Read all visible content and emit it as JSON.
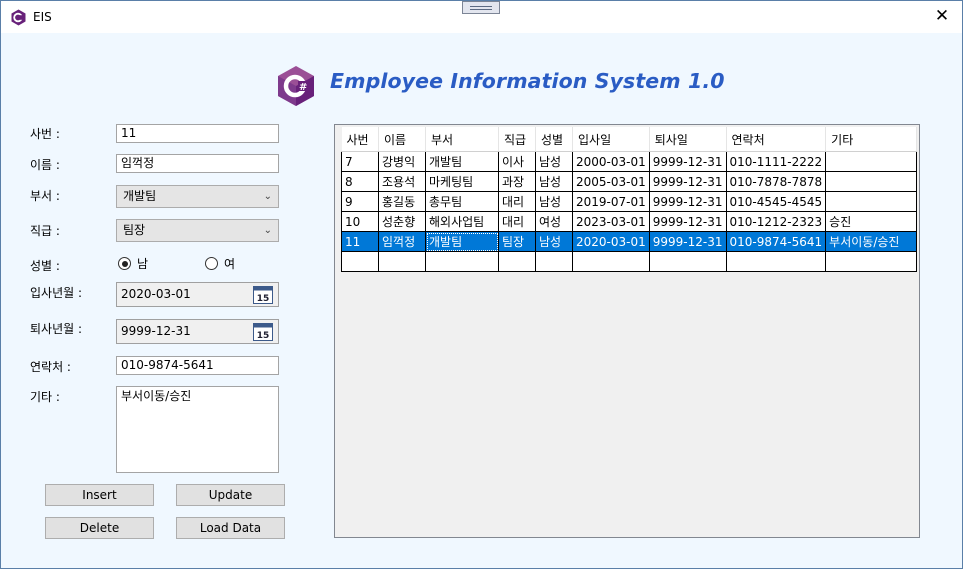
{
  "window": {
    "title": "EIS",
    "close_glyph": "✕"
  },
  "header": {
    "title": "Employee Information System 1.0",
    "logo_icon": "csharp-logo-icon"
  },
  "form": {
    "id_label": "사번 :",
    "id_value": "11",
    "name_label": "이름 :",
    "name_value": "임꺽정",
    "dept_label": "부서 :",
    "dept_value": "개발팀",
    "rank_label": "직급 :",
    "rank_value": "팀장",
    "gender_label": "성별 :",
    "gender_male": "남",
    "gender_female": "여",
    "gender_selected": "남",
    "hire_label": "입사년월 :",
    "hire_value": "2020-03-01",
    "leave_label": "퇴사년월 :",
    "leave_value": "9999-12-31",
    "contact_label": "연락처 :",
    "contact_value": "010-9874-5641",
    "memo_label": "기타 :",
    "memo_value": "부서이동/승진",
    "calendar_day": "15"
  },
  "buttons": {
    "insert": "Insert",
    "update": "Update",
    "delete": "Delete",
    "load": "Load Data"
  },
  "grid": {
    "columns": [
      "사번",
      "이름",
      "부서",
      "직급",
      "성별",
      "입사일",
      "퇴사일",
      "연락처",
      "기타"
    ],
    "rows": [
      [
        "7",
        "강병익",
        "개발팀",
        "이사",
        "남성",
        "2000-03-01",
        "9999-12-31",
        "010-1111-2222",
        ""
      ],
      [
        "8",
        "조용석",
        "마케팅팀",
        "과장",
        "남성",
        "2005-03-01",
        "9999-12-31",
        "010-7878-7878",
        ""
      ],
      [
        "9",
        "홍길동",
        "총무팀",
        "대리",
        "남성",
        "2019-07-01",
        "9999-12-31",
        "010-4545-4545",
        ""
      ],
      [
        "10",
        "성춘향",
        "해외사업팀",
        "대리",
        "여성",
        "2023-03-01",
        "9999-12-31",
        "010-1212-2323",
        "승진"
      ],
      [
        "11",
        "임꺽정",
        "개발팀",
        "팀장",
        "남성",
        "2020-03-01",
        "9999-12-31",
        "010-9874-5641",
        "부서이동/승진"
      ]
    ],
    "selected_row": 4,
    "colors": {
      "selection": "#0078d7",
      "title_accent": "#2a5cc4"
    }
  }
}
